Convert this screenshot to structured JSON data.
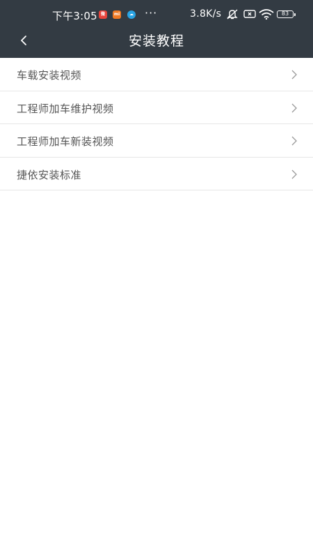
{
  "status_bar": {
    "time": "下午3:05",
    "dots": "···",
    "network_speed": "3.8K/s",
    "battery": "83",
    "app_badges": [
      "weibo-icon",
      "mi-icon",
      "cloud-icon"
    ]
  },
  "header": {
    "title": "安装教程",
    "back_icon": "chevron-left-icon",
    "background": "#333b43"
  },
  "menu": {
    "items": [
      {
        "label": "车载安装视频",
        "icon": "chevron-right-icon"
      },
      {
        "label": "工程师加车维护视频",
        "icon": "chevron-right-icon"
      },
      {
        "label": "工程师加车新装视频",
        "icon": "chevron-right-icon"
      },
      {
        "label": "捷依安装标准",
        "icon": "chevron-right-icon"
      }
    ]
  }
}
